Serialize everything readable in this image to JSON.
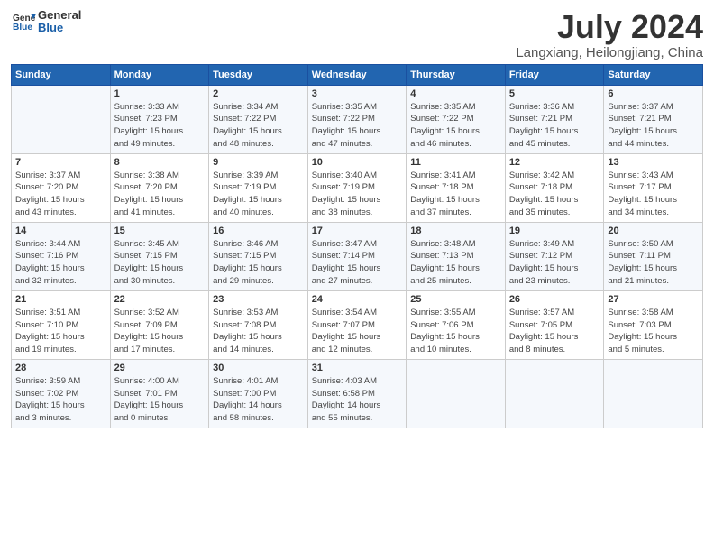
{
  "logo": {
    "line1": "General",
    "line2": "Blue"
  },
  "title": "July 2024",
  "location": "Langxiang, Heilongjiang, China",
  "headers": [
    "Sunday",
    "Monday",
    "Tuesday",
    "Wednesday",
    "Thursday",
    "Friday",
    "Saturday"
  ],
  "weeks": [
    [
      {
        "day": "",
        "info": ""
      },
      {
        "day": "1",
        "info": "Sunrise: 3:33 AM\nSunset: 7:23 PM\nDaylight: 15 hours\nand 49 minutes."
      },
      {
        "day": "2",
        "info": "Sunrise: 3:34 AM\nSunset: 7:22 PM\nDaylight: 15 hours\nand 48 minutes."
      },
      {
        "day": "3",
        "info": "Sunrise: 3:35 AM\nSunset: 7:22 PM\nDaylight: 15 hours\nand 47 minutes."
      },
      {
        "day": "4",
        "info": "Sunrise: 3:35 AM\nSunset: 7:22 PM\nDaylight: 15 hours\nand 46 minutes."
      },
      {
        "day": "5",
        "info": "Sunrise: 3:36 AM\nSunset: 7:21 PM\nDaylight: 15 hours\nand 45 minutes."
      },
      {
        "day": "6",
        "info": "Sunrise: 3:37 AM\nSunset: 7:21 PM\nDaylight: 15 hours\nand 44 minutes."
      }
    ],
    [
      {
        "day": "7",
        "info": "Sunrise: 3:37 AM\nSunset: 7:20 PM\nDaylight: 15 hours\nand 43 minutes."
      },
      {
        "day": "8",
        "info": "Sunrise: 3:38 AM\nSunset: 7:20 PM\nDaylight: 15 hours\nand 41 minutes."
      },
      {
        "day": "9",
        "info": "Sunrise: 3:39 AM\nSunset: 7:19 PM\nDaylight: 15 hours\nand 40 minutes."
      },
      {
        "day": "10",
        "info": "Sunrise: 3:40 AM\nSunset: 7:19 PM\nDaylight: 15 hours\nand 38 minutes."
      },
      {
        "day": "11",
        "info": "Sunrise: 3:41 AM\nSunset: 7:18 PM\nDaylight: 15 hours\nand 37 minutes."
      },
      {
        "day": "12",
        "info": "Sunrise: 3:42 AM\nSunset: 7:18 PM\nDaylight: 15 hours\nand 35 minutes."
      },
      {
        "day": "13",
        "info": "Sunrise: 3:43 AM\nSunset: 7:17 PM\nDaylight: 15 hours\nand 34 minutes."
      }
    ],
    [
      {
        "day": "14",
        "info": "Sunrise: 3:44 AM\nSunset: 7:16 PM\nDaylight: 15 hours\nand 32 minutes."
      },
      {
        "day": "15",
        "info": "Sunrise: 3:45 AM\nSunset: 7:15 PM\nDaylight: 15 hours\nand 30 minutes."
      },
      {
        "day": "16",
        "info": "Sunrise: 3:46 AM\nSunset: 7:15 PM\nDaylight: 15 hours\nand 29 minutes."
      },
      {
        "day": "17",
        "info": "Sunrise: 3:47 AM\nSunset: 7:14 PM\nDaylight: 15 hours\nand 27 minutes."
      },
      {
        "day": "18",
        "info": "Sunrise: 3:48 AM\nSunset: 7:13 PM\nDaylight: 15 hours\nand 25 minutes."
      },
      {
        "day": "19",
        "info": "Sunrise: 3:49 AM\nSunset: 7:12 PM\nDaylight: 15 hours\nand 23 minutes."
      },
      {
        "day": "20",
        "info": "Sunrise: 3:50 AM\nSunset: 7:11 PM\nDaylight: 15 hours\nand 21 minutes."
      }
    ],
    [
      {
        "day": "21",
        "info": "Sunrise: 3:51 AM\nSunset: 7:10 PM\nDaylight: 15 hours\nand 19 minutes."
      },
      {
        "day": "22",
        "info": "Sunrise: 3:52 AM\nSunset: 7:09 PM\nDaylight: 15 hours\nand 17 minutes."
      },
      {
        "day": "23",
        "info": "Sunrise: 3:53 AM\nSunset: 7:08 PM\nDaylight: 15 hours\nand 14 minutes."
      },
      {
        "day": "24",
        "info": "Sunrise: 3:54 AM\nSunset: 7:07 PM\nDaylight: 15 hours\nand 12 minutes."
      },
      {
        "day": "25",
        "info": "Sunrise: 3:55 AM\nSunset: 7:06 PM\nDaylight: 15 hours\nand 10 minutes."
      },
      {
        "day": "26",
        "info": "Sunrise: 3:57 AM\nSunset: 7:05 PM\nDaylight: 15 hours\nand 8 minutes."
      },
      {
        "day": "27",
        "info": "Sunrise: 3:58 AM\nSunset: 7:03 PM\nDaylight: 15 hours\nand 5 minutes."
      }
    ],
    [
      {
        "day": "28",
        "info": "Sunrise: 3:59 AM\nSunset: 7:02 PM\nDaylight: 15 hours\nand 3 minutes."
      },
      {
        "day": "29",
        "info": "Sunrise: 4:00 AM\nSunset: 7:01 PM\nDaylight: 15 hours\nand 0 minutes."
      },
      {
        "day": "30",
        "info": "Sunrise: 4:01 AM\nSunset: 7:00 PM\nDaylight: 14 hours\nand 58 minutes."
      },
      {
        "day": "31",
        "info": "Sunrise: 4:03 AM\nSunset: 6:58 PM\nDaylight: 14 hours\nand 55 minutes."
      },
      {
        "day": "",
        "info": ""
      },
      {
        "day": "",
        "info": ""
      },
      {
        "day": "",
        "info": ""
      }
    ]
  ]
}
